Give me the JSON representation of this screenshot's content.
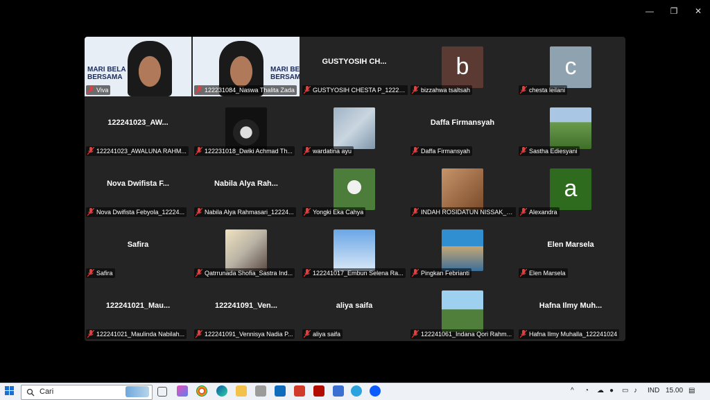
{
  "window_controls": {
    "minimize": "—",
    "restore": "❐",
    "close": "✕"
  },
  "tiles": [
    {
      "name": "Viva",
      "type": "video",
      "banner": "MARI BELA\nBERSAMA"
    },
    {
      "name": "122231084_Naswa Thalita Zada",
      "type": "video",
      "banner": "MARI BEI\nBERSAMA",
      "active": true
    },
    {
      "name": "GUSTYOSIH CHESTA P_122241...",
      "type": "text",
      "display": "GUSTYOSIH  CH..."
    },
    {
      "name": "bizzahwa tsaltsah",
      "type": "letter",
      "letter": "b",
      "color": "#5a3a32"
    },
    {
      "name": "chesta leilani",
      "type": "letter",
      "letter": "c",
      "color": "#8fa2b0"
    },
    {
      "name": "122241023_AWALUNA RAHM...",
      "type": "text",
      "display": "122241023_AW..."
    },
    {
      "name": "122231018_Dwiki Achmad Th...",
      "type": "photo",
      "photo": "dwiki"
    },
    {
      "name": "wardatina ayu",
      "type": "photo",
      "photo": "wardatina"
    },
    {
      "name": "Daffa Firmansyah",
      "type": "text",
      "display": "Daffa Firmansyah"
    },
    {
      "name": "Sastha Ediesyani",
      "type": "photo",
      "photo": "sastha"
    },
    {
      "name": "Nova Dwifista Febyola_12224...",
      "type": "text",
      "display": "Nova Dwifista F..."
    },
    {
      "name": "Nabila Alya Rahmasari_12224...",
      "type": "text",
      "display": "Nabila Alya Rah..."
    },
    {
      "name": "Yongki Eka Cahya",
      "type": "photo",
      "photo": "yongki"
    },
    {
      "name": "INDAH ROSIDATUN NISSAK_B...",
      "type": "photo",
      "photo": "indah"
    },
    {
      "name": "Alexandra",
      "type": "letter",
      "letter": "a",
      "color": "#2f6b1e"
    },
    {
      "name": "Safira",
      "type": "text",
      "display": "Safira"
    },
    {
      "name": "Qatrrunada Shofia_Sastra Ind...",
      "type": "photo",
      "photo": "qatr"
    },
    {
      "name": "122241017_Embun Selena Ra...",
      "type": "photo",
      "photo": "embun"
    },
    {
      "name": "Pingkan Febrianti",
      "type": "photo",
      "photo": "pingkan"
    },
    {
      "name": "Elen Marsela",
      "type": "text",
      "display": "Elen Marsela"
    },
    {
      "name": "122241021_Maulinda Nabilah...",
      "type": "text",
      "display": "122241021_Mau..."
    },
    {
      "name": "122241091_Vennisya Nadia P...",
      "type": "text",
      "display": "122241091_Ven..."
    },
    {
      "name": "aliya saifa",
      "type": "text",
      "display": "aliya saifa"
    },
    {
      "name": "122241061_Indana Qori Rahm...",
      "type": "photo",
      "photo": "indana"
    },
    {
      "name": "Hafna Ilmy Muhalla_122241024",
      "type": "text",
      "display": "Hafna Ilmy Muh..."
    }
  ],
  "taskbar": {
    "search_label": "Cari",
    "lang": "IND",
    "time": "15.00"
  }
}
